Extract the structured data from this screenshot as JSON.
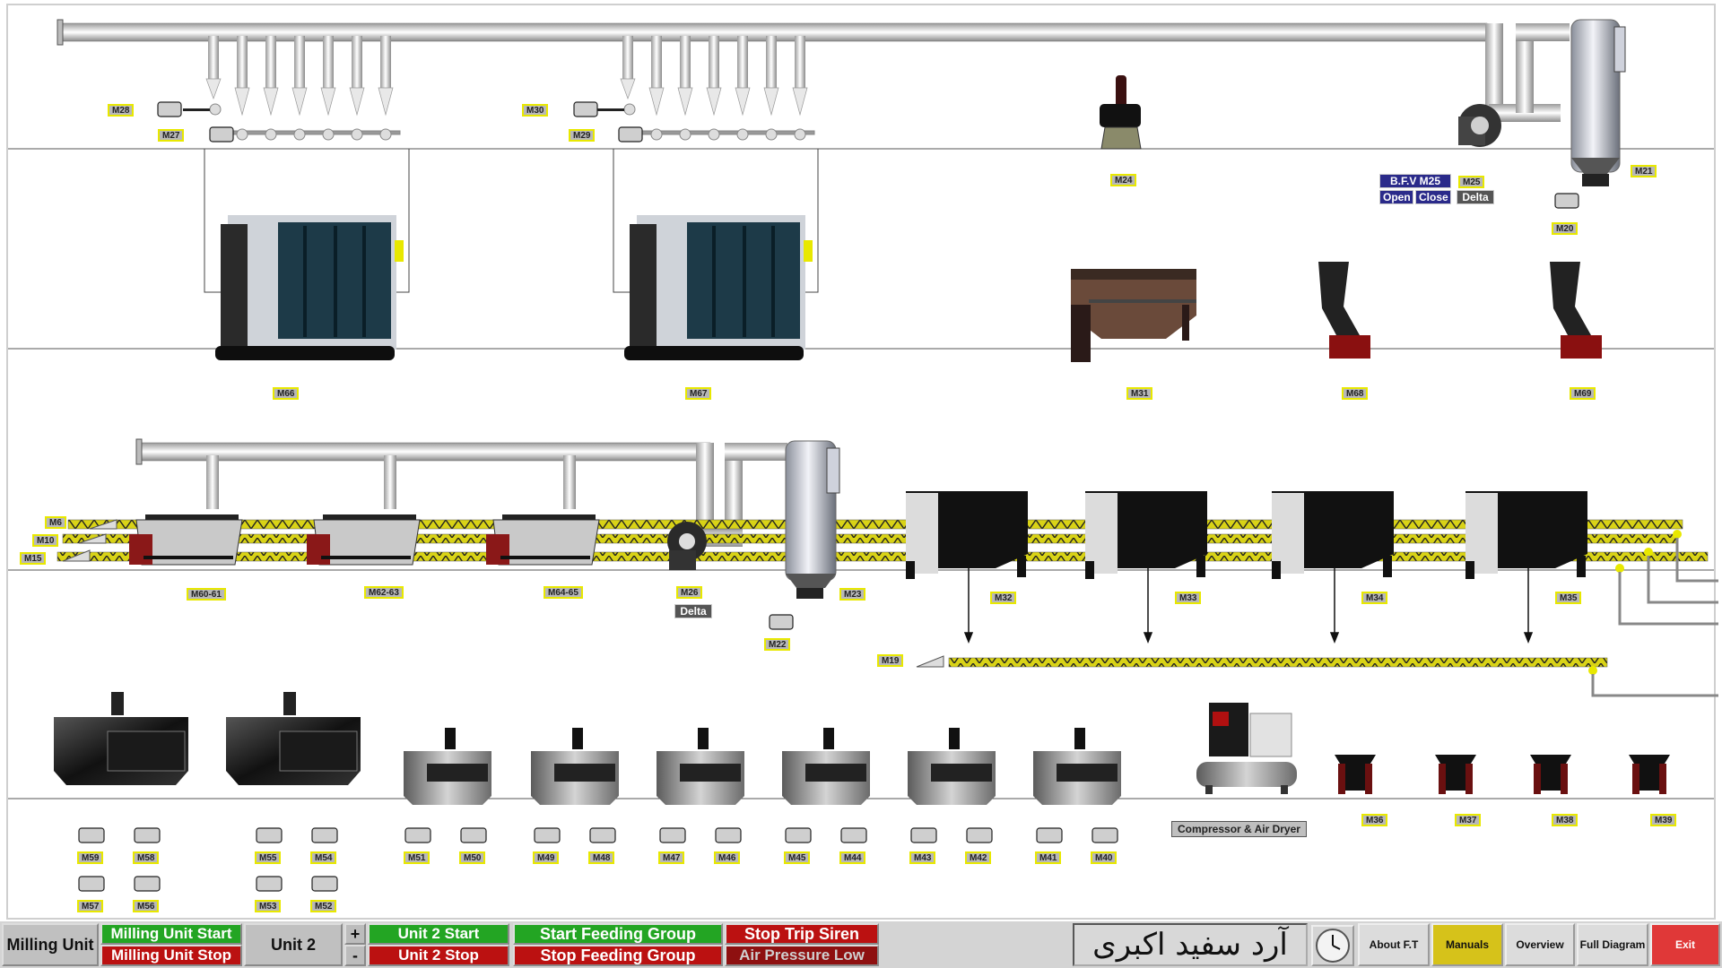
{
  "machines": {
    "m28": "M28",
    "m27": "M27",
    "m30": "M30",
    "m29": "M29",
    "m24": "M24",
    "m21": "M21",
    "m25": "M25",
    "m20": "M20",
    "m66": "M66",
    "m67": "M67",
    "m31": "M31",
    "m68": "M68",
    "m69": "M69",
    "m6": "M6",
    "m10": "M10",
    "m15": "M15",
    "m6061": "M60-61",
    "m6263": "M62-63",
    "m6465": "M64-65",
    "m26": "M26",
    "m23": "M23",
    "m22": "M22",
    "m32": "M32",
    "m33": "M33",
    "m34": "M34",
    "m35": "M35",
    "m19": "M19",
    "m59": "M59",
    "m58": "M58",
    "m57": "M57",
    "m56": "M56",
    "m55": "M55",
    "m54": "M54",
    "m53": "M53",
    "m52": "M52",
    "m51": "M51",
    "m50": "M50",
    "m49": "M49",
    "m48": "M48",
    "m47": "M47",
    "m46": "M46",
    "m45": "M45",
    "m44": "M44",
    "m43": "M43",
    "m42": "M42",
    "m41": "M41",
    "m40": "M40",
    "m36": "M36",
    "m37": "M37",
    "m38": "M38",
    "m39": "M39"
  },
  "valves": {
    "bfv_label": "B.F.V M25",
    "open_label": "Open",
    "close_label": "Close",
    "m25_mode": "Delta",
    "m26_mode": "Delta"
  },
  "compressor": {
    "label": "Compressor & Air Dryer"
  },
  "toolbar": {
    "milling_unit": "Milling Unit",
    "milling_start": "Milling Unit Start",
    "milling_stop": "Milling Unit Stop",
    "unit2": "Unit 2",
    "plus": "+",
    "minus": "-",
    "unit2_start": "Unit 2 Start",
    "unit2_stop": "Unit 2 Stop",
    "feed_start": "Start Feeding Group",
    "feed_stop": "Stop Feeding Group",
    "stop_siren": "Stop Trip Siren",
    "air_low": "Air Pressure Low",
    "brand": "آرد سفید اکبری",
    "about": "About F.T",
    "manuals": "Manuals",
    "overview": "Overview",
    "full_diagram": "Full Diagram",
    "exit": "Exit"
  },
  "colors": {
    "start_green": "#23a523",
    "stop_red": "#bb1111",
    "manuals_yellow": "#d6c21a",
    "exit_red": "#e03838",
    "tag_border": "#e8e800"
  }
}
